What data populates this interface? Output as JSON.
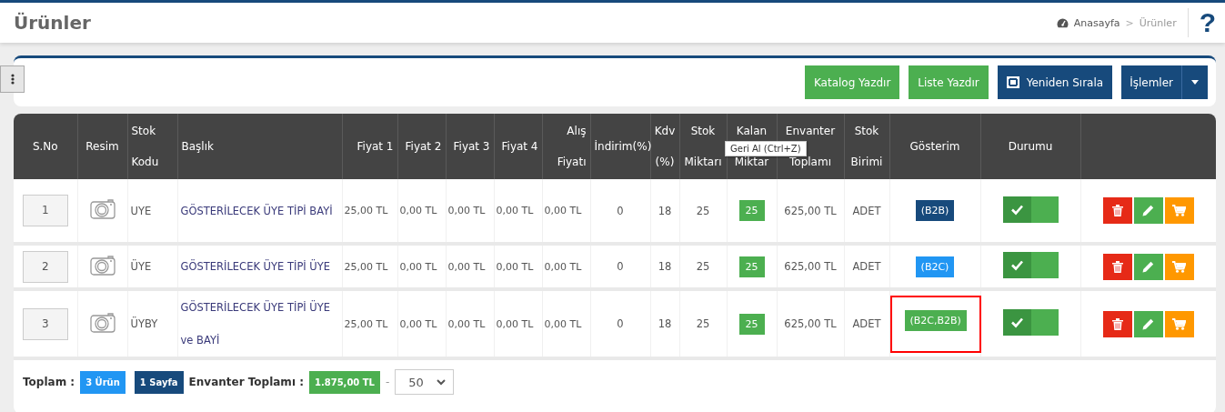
{
  "page_title": "Ürünler",
  "breadcrumb": {
    "items": [
      "Anasayfa",
      "Ürünler"
    ],
    "separator": ">"
  },
  "help_button": "?",
  "toolbar": {
    "buttons": [
      {
        "label": "Katalog Yazdır",
        "kind": "success"
      },
      {
        "label": "Liste Yazdır",
        "kind": "success"
      },
      {
        "label": "Yeniden Sırala",
        "kind": "reorder"
      },
      {
        "label": "İşlemler",
        "kind": "dropdown"
      }
    ]
  },
  "table": {
    "columns": [
      "S.No",
      "Resim",
      "Stok Kodu",
      "Başlık",
      "Fiyat 1",
      "Fiyat 2",
      "Fiyat 3",
      "Fiyat 4",
      "Alış Fiyatı",
      "İndirim(%)",
      "Kdv (%)",
      "Stok Miktarı",
      "Kalan Miktar",
      "Envanter Toplamı",
      "Stok Birimi",
      "Gösterim",
      "Durumu"
    ],
    "rows": [
      {
        "sno": "1",
        "stock_code": "UYE",
        "title": "GÖSTERİLECEK ÜYE TİPİ BAYİ",
        "prices": [
          "25,00 TL",
          "0,00 TL",
          "0,00 TL",
          "0,00 TL",
          "0,00 TL"
        ],
        "discount": "0",
        "vat": "18",
        "stock": "25",
        "remaining": "25",
        "inventory_total": "625,00 TL",
        "unit": "ADET",
        "display": {
          "label": "(B2B)",
          "color": "#174a7c",
          "highlighted": false
        },
        "status_on": true
      },
      {
        "sno": "2",
        "stock_code": "ÜYE",
        "title": "GÖSTERİLECEK ÜYE TİPİ ÜYE",
        "prices": [
          "25,00 TL",
          "0,00 TL",
          "0,00 TL",
          "0,00 TL",
          "0,00 TL"
        ],
        "discount": "0",
        "vat": "18",
        "stock": "25",
        "remaining": "25",
        "inventory_total": "625,00 TL",
        "unit": "ADET",
        "display": {
          "label": "(B2C)",
          "color": "#2196f3",
          "highlighted": false
        },
        "status_on": true
      },
      {
        "sno": "3",
        "stock_code": "ÜYBY",
        "title": "GÖSTERİLECEK ÜYE TİPİ ÜYE ve BAYİ",
        "prices": [
          "25,00 TL",
          "0,00 TL",
          "0,00 TL",
          "0,00 TL",
          "0,00 TL"
        ],
        "discount": "0",
        "vat": "18",
        "stock": "25",
        "remaining": "25",
        "inventory_total": "625,00 TL",
        "unit": "ADET",
        "display": {
          "label": "(B2C,B2B)",
          "color": "#4caf50",
          "highlighted": true
        },
        "status_on": true
      }
    ]
  },
  "tooltip": "Geri Al (Ctrl+Z)",
  "footer": {
    "total_label": "Toplam :",
    "product_count": "3 Ürün",
    "page_count": "1 Sayfa",
    "inventory_label": "Envanter Toplamı :",
    "inventory_total": "1.875,00 TL",
    "separator": "-",
    "page_size": "50"
  }
}
